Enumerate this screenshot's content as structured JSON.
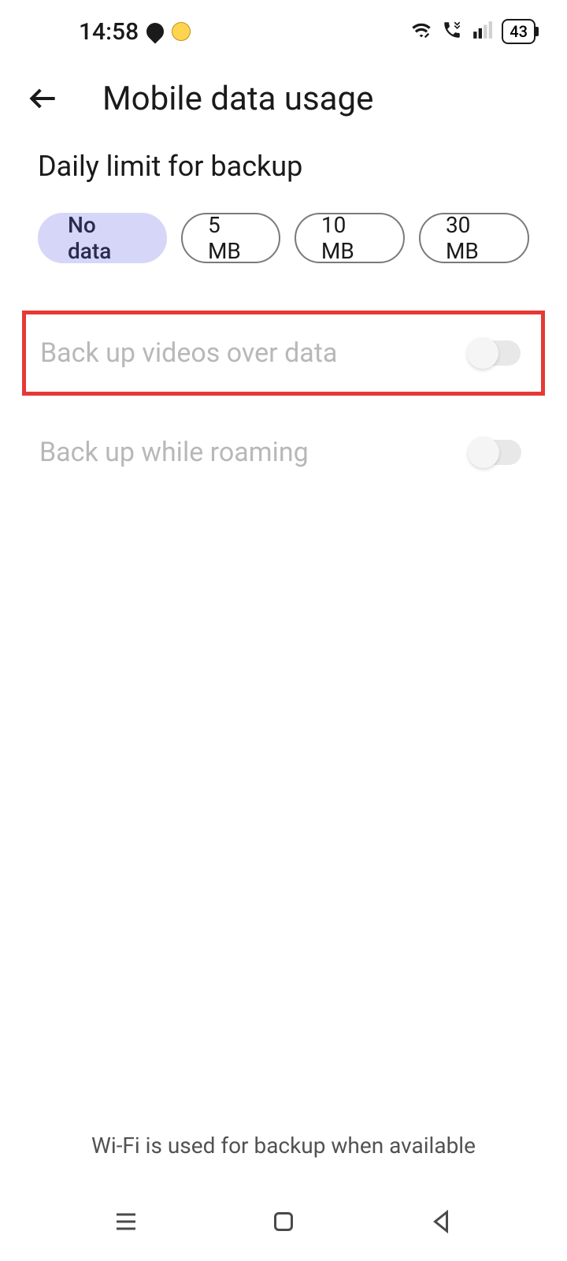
{
  "status_bar": {
    "time": "14:58",
    "battery": "43"
  },
  "header": {
    "title": "Mobile data usage"
  },
  "section": {
    "title": "Daily limit for backup"
  },
  "chips": [
    {
      "label": "No data",
      "selected": true
    },
    {
      "label": "5 MB",
      "selected": false
    },
    {
      "label": "10 MB",
      "selected": false
    },
    {
      "label": "30 MB",
      "selected": false
    }
  ],
  "settings": [
    {
      "label": "Back up videos over data",
      "enabled": false,
      "disabled_appearance": true,
      "highlighted": true
    },
    {
      "label": "Back up while roaming",
      "enabled": false,
      "disabled_appearance": true,
      "highlighted": false
    }
  ],
  "footer": "Wi-Fi is used for backup when available"
}
